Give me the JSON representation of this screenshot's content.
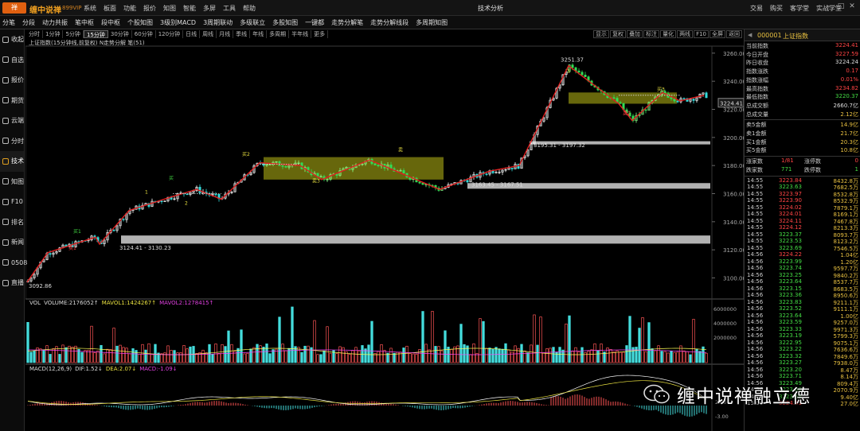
{
  "titlebar": {
    "app_name": "缠中说禅",
    "vip": "899VIP",
    "menu": [
      "系统",
      "板面",
      "功能",
      "报价",
      "知图",
      "智能",
      "多屏",
      "工具",
      "帮助"
    ],
    "center_title": "技术分析",
    "right_links": [
      "交易",
      "购买",
      "客学堂",
      "实战学堂"
    ],
    "window_controls": [
      "—",
      "□",
      "✕"
    ]
  },
  "toolbar": {
    "items": [
      "分笔",
      "分段",
      "动力共振",
      "笔中枢",
      "段中枢",
      "个股知图",
      "3级别MACD",
      "3周期联动",
      "多级联立",
      "多股知图",
      "一键都",
      "走势分解笔",
      "走势分解线段",
      "多周期知图"
    ]
  },
  "sidebar": {
    "items": [
      "收起",
      "自选",
      "报价",
      "期货",
      "云端",
      "分时",
      "技术",
      "知图",
      "F10",
      "排名",
      "新闻",
      "0508",
      "直播"
    ],
    "active_index": 6
  },
  "periodbar": {
    "items": [
      "分时",
      "1分钟",
      "5分钟",
      "15分钟",
      "30分钟",
      "60分钟",
      "120分钟",
      "日线",
      "周线",
      "月线",
      "季线",
      "年线",
      "多周期",
      "半年线",
      "更多"
    ],
    "active_index": 3,
    "right_items": [
      "显示",
      "复权",
      "叠加",
      "标注",
      "量化",
      "两线",
      "F10",
      "全屏",
      "返回"
    ]
  },
  "chart": {
    "info": "上证指数(15分钟线,前复权) N走势分解 笔(51)",
    "accent_line": "#dd2020",
    "zone_color": "#8a8a10",
    "band_color": "#d0d0d0",
    "price_labels": [
      "3260.00",
      "3240.00",
      "3220.00",
      "3200.00",
      "3180.00",
      "3160.00",
      "3140.00",
      "3120.00",
      "3100.00"
    ],
    "current_price_tag": "3224.41",
    "annotations": [
      "3251.37",
      "3195.31 - 3197.32",
      "3163.45 - 3167.51",
      "3124.41 - 3130.23",
      "3092.86"
    ],
    "markers": [
      "买1",
      "买2",
      "买3",
      "卖1",
      "卖2",
      "卖3",
      "买",
      "卖",
      "1",
      "2",
      "3"
    ]
  },
  "volume": {
    "label": "VOL",
    "volume": "VOLUME:2176052↑",
    "mavol1": "MAVOL1:1424267↑",
    "mavol2": "MAVOL2:1278415↑",
    "axis": [
      "6000000",
      "4000000",
      "2000000"
    ],
    "colors": {
      "up": "#ff5555",
      "down": "#44dddd",
      "ma1": "#ffff55",
      "ma2": "#ff44ff"
    }
  },
  "macd": {
    "label": "MACD(12,26,9)",
    "dif": "DIF:1.52↓",
    "dea": "DEA:2.07↓",
    "macd": "MACD:-1.09↓",
    "axis": [
      "2.00",
      "-3.00"
    ]
  },
  "quote": {
    "code": "000001",
    "name": "上证指数",
    "fields": [
      {
        "label": "当前指数",
        "value": "3224.41",
        "color": "#ff4444"
      },
      {
        "label": "今日开盘",
        "value": "3227.59",
        "color": "#ff4444"
      },
      {
        "label": "昨日收盘",
        "value": "3224.24",
        "color": "#dddddd"
      },
      {
        "label": "指数涨跌",
        "value": "0.17",
        "color": "#ff4444"
      },
      {
        "label": "指数涨幅",
        "value": "0.01%",
        "color": "#ff4444"
      },
      {
        "label": "最高指数",
        "value": "3234.82",
        "color": "#ff4444"
      },
      {
        "label": "最低指数",
        "value": "3220.37",
        "color": "#44dd44"
      },
      {
        "label": "总成交额",
        "value": "2660.7亿",
        "color": "#dddddd"
      },
      {
        "label": "总成交量",
        "value": "2.12亿",
        "color": "#e8c040"
      }
    ],
    "orders": [
      {
        "label": "卖5金额",
        "value": "14.9亿"
      },
      {
        "label": "卖1金额",
        "value": "21.7亿"
      },
      {
        "label": "买1金额",
        "value": "20.3亿"
      },
      {
        "label": "买5金额",
        "value": "10.8亿"
      }
    ],
    "breadth": [
      {
        "label": "涨家数",
        "count": "1/81",
        "label2": "涨停数",
        "count2": "0"
      },
      {
        "label": "跌家数",
        "count": "771",
        "label2": "跌停数",
        "count2": "1"
      }
    ]
  },
  "trades": [
    {
      "time": "14:55",
      "price": "3223.84",
      "vol": "8432.8万",
      "dir": "up"
    },
    {
      "time": "14:55",
      "price": "3223.63",
      "vol": "7682.5万",
      "dir": "down"
    },
    {
      "time": "14:55",
      "price": "3223.97",
      "vol": "8532.8万",
      "dir": "up"
    },
    {
      "time": "14:55",
      "price": "3223.90",
      "vol": "8532.9万",
      "dir": "up"
    },
    {
      "time": "14:55",
      "price": "3224.02",
      "vol": "7879.1万",
      "dir": "up"
    },
    {
      "time": "14:55",
      "price": "3224.01",
      "vol": "8169.1万",
      "dir": "up"
    },
    {
      "time": "14:55",
      "price": "3224.11",
      "vol": "7467.8万",
      "dir": "up"
    },
    {
      "time": "14:55",
      "price": "3224.12",
      "vol": "8213.3万",
      "dir": "up"
    },
    {
      "time": "14:55",
      "price": "3223.37",
      "vol": "8093.7万",
      "dir": "down"
    },
    {
      "time": "14:55",
      "price": "3223.53",
      "vol": "8123.2万",
      "dir": "down"
    },
    {
      "time": "14:55",
      "price": "3223.69",
      "vol": "7546.5万",
      "dir": "down"
    },
    {
      "time": "14:56",
      "price": "3224.22",
      "vol": "1.04亿",
      "dir": "up"
    },
    {
      "time": "14:56",
      "price": "3223.99",
      "vol": "1.20亿",
      "dir": "down"
    },
    {
      "time": "14:56",
      "price": "3223.74",
      "vol": "9597.7万",
      "dir": "down"
    },
    {
      "time": "14:56",
      "price": "3223.25",
      "vol": "9840.2万",
      "dir": "down"
    },
    {
      "time": "14:56",
      "price": "3223.64",
      "vol": "8537.7万",
      "dir": "down"
    },
    {
      "time": "14:56",
      "price": "3223.15",
      "vol": "8683.5万",
      "dir": "down"
    },
    {
      "time": "14:56",
      "price": "3223.36",
      "vol": "8950.6万",
      "dir": "down"
    },
    {
      "time": "14:56",
      "price": "3223.83",
      "vol": "9211.1万",
      "dir": "down"
    },
    {
      "time": "14:56",
      "price": "3223.52",
      "vol": "9111.1万",
      "dir": "down"
    },
    {
      "time": "14:56",
      "price": "3223.64",
      "vol": "1.00亿",
      "dir": "down"
    },
    {
      "time": "14:56",
      "price": "3223.59",
      "vol": "9257.0万",
      "dir": "down"
    },
    {
      "time": "14:56",
      "price": "3223.33",
      "vol": "9971.3万",
      "dir": "down"
    },
    {
      "time": "14:56",
      "price": "3223.19",
      "vol": "5799.3万",
      "dir": "down"
    },
    {
      "time": "14:56",
      "price": "3222.95",
      "vol": "9075.1万",
      "dir": "down"
    },
    {
      "time": "14:56",
      "price": "3223.22",
      "vol": "7636.6万",
      "dir": "down"
    },
    {
      "time": "14:56",
      "price": "3223.32",
      "vol": "7849.6万",
      "dir": "down"
    },
    {
      "time": "14:56",
      "price": "3223.27",
      "vol": "7938.0万",
      "dir": "down"
    },
    {
      "time": "14:56",
      "price": "3223.20",
      "vol": "8.47万",
      "dir": "down"
    },
    {
      "time": "14:56",
      "price": "3223.71",
      "vol": "8.14万",
      "dir": "down"
    },
    {
      "time": "14:56",
      "price": "3223.49",
      "vol": "809.4万",
      "dir": "down"
    },
    {
      "time": "14:56",
      "price": "3223.60",
      "vol": "2070.9万",
      "dir": "down"
    },
    {
      "time": "14:56",
      "price": "3223.68",
      "vol": "9.40亿",
      "dir": "down"
    },
    {
      "time": "15:00",
      "price": "3224.41",
      "vol": "27.0亿",
      "dir": "up"
    }
  ],
  "watermark": {
    "text": "缠中说禅融立德"
  }
}
